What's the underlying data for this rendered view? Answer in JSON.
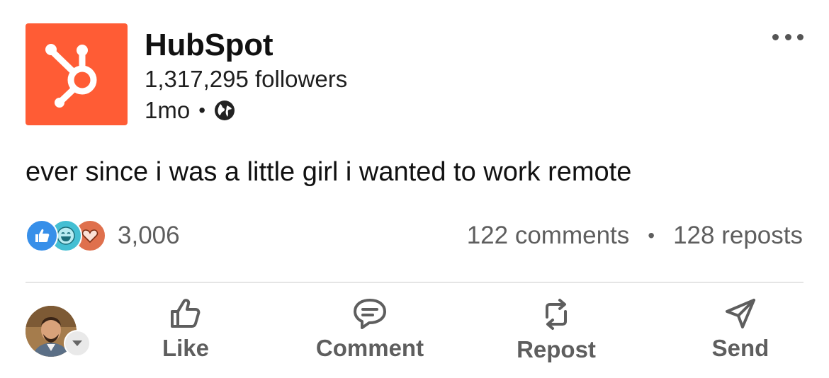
{
  "post": {
    "author": {
      "name": "HubSpot",
      "followers": "1,317,295 followers",
      "time": "1mo",
      "separator": "•",
      "logo_icon": "hubspot-sprocket-logo",
      "visibility_icon": "globe-icon"
    },
    "text": "ever since i was a little girl i wanted to work remote",
    "stats": {
      "reaction_icons": [
        "like-reaction-icon",
        "funny-reaction-icon",
        "love-reaction-icon"
      ],
      "reactions_count": "3,006",
      "comments": "122 comments",
      "separator": "•",
      "reposts": "128 reposts"
    },
    "actions": {
      "like": "Like",
      "comment": "Comment",
      "repost": "Repost",
      "send": "Send"
    }
  },
  "colors": {
    "hubspot_orange": "#ff5c35",
    "like_blue": "#378fe9",
    "funny_teal": "#44bfd3",
    "love_orange": "#df704d",
    "secondary_text": "#5e5e5e"
  }
}
